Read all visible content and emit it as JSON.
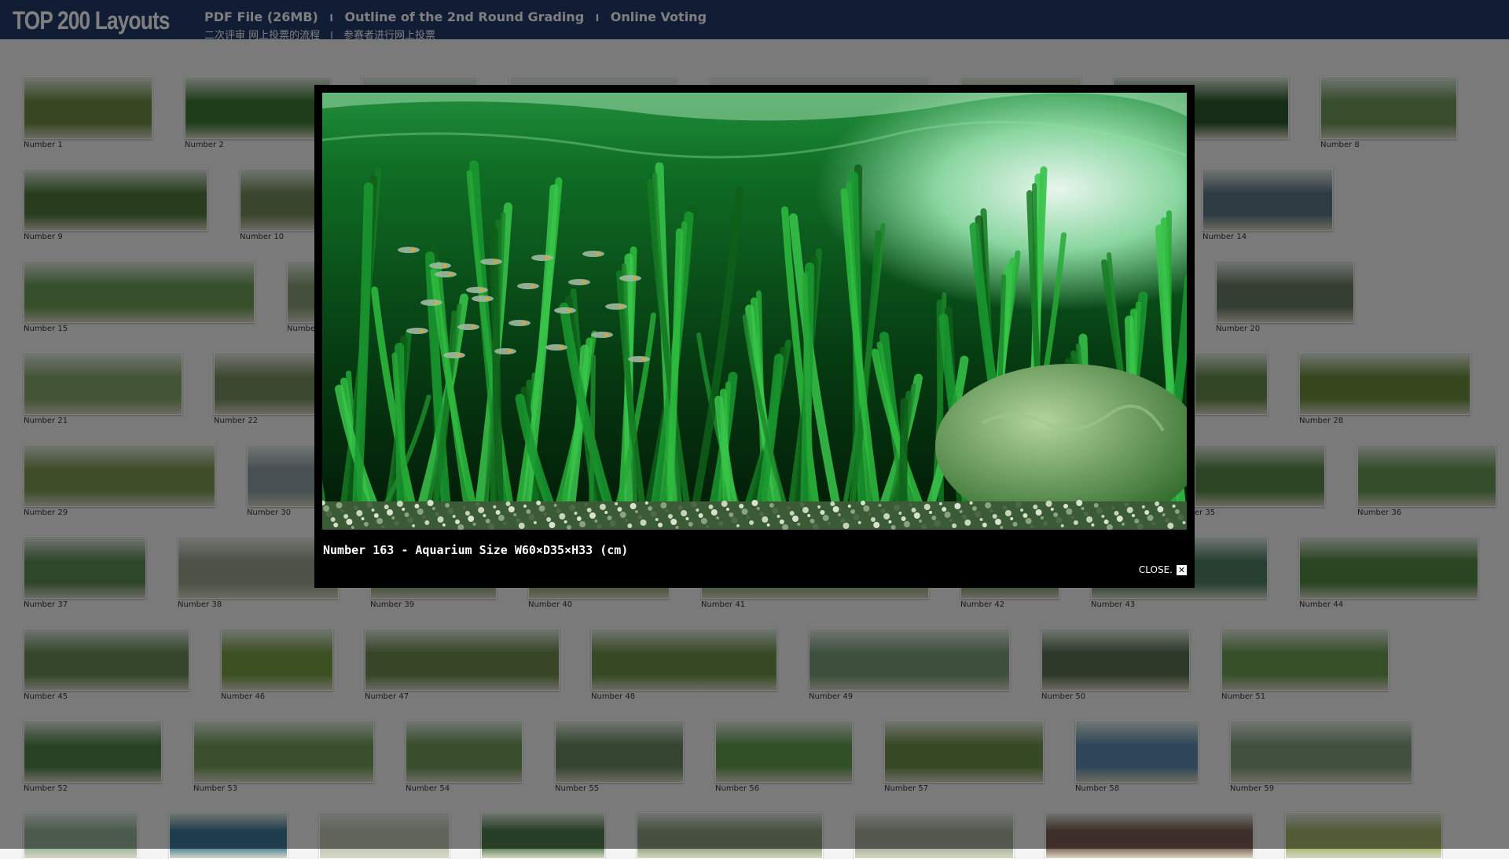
{
  "header": {
    "logo": "TOP 200 Layouts",
    "links": [
      "PDF File (26MB)",
      "Outline of the 2nd Round Grading",
      "Online Voting"
    ],
    "separator": "I",
    "sub_links": [
      "二次评审 网上投票的流程",
      "参赛者进行网上投票"
    ]
  },
  "gallery": {
    "items": [
      {
        "label": "Number 1",
        "c": "#6d8f45"
      },
      {
        "label": "Number 2",
        "c": "#3f7a35"
      },
      {
        "label": "",
        "c": "#96b79a"
      },
      {
        "label": "",
        "c": "#b2c4c6"
      },
      {
        "label": "",
        "c": "#bfcfcf"
      },
      {
        "label": "",
        "c": "#8fb66a"
      },
      {
        "label": "",
        "c": "#2f5b2c"
      },
      {
        "label": "Number 8",
        "c": "#6e9a57"
      },
      {
        "label": "Number 9",
        "c": "#4f7b3a"
      },
      {
        "label": "Number 10",
        "c": "#758d5b"
      },
      {
        "label": "Number 14",
        "c": "#5b7986"
      },
      {
        "label": "Number 15",
        "c": "#6f9f55"
      },
      {
        "label": "Number",
        "c": "#8aa27a"
      },
      {
        "label": "Number 20",
        "c": "#687c66"
      },
      {
        "label": "Number 21",
        "c": "#88a86c"
      },
      {
        "label": "Number 22",
        "c": "#7a9160"
      },
      {
        "label": "",
        "c": "#678d4a"
      },
      {
        "label": "Number 28",
        "c": "#6c8f3a"
      },
      {
        "label": "Number 29",
        "c": "#7c9c52"
      },
      {
        "label": "Number 30",
        "c": "#8fa0a6"
      },
      {
        "label": "er 35",
        "c": "#5a8b48"
      },
      {
        "label": "Number 36",
        "c": "#6a9a56"
      },
      {
        "label": "Number 37",
        "c": "#5d8e56"
      },
      {
        "label": "Number 38",
        "c": "#9aa38c"
      },
      {
        "label": "Number 39",
        "c": "#6e9c5c"
      },
      {
        "label": "Number 40",
        "c": "#749a50"
      },
      {
        "label": "Number 41",
        "c": "#7aa061"
      },
      {
        "label": "Number 42",
        "c": "#628e58"
      },
      {
        "label": "Number 43",
        "c": "#4f8064"
      },
      {
        "label": "Number 44",
        "c": "#548a42"
      },
      {
        "label": "Number 45",
        "c": "#6c8d56"
      },
      {
        "label": "Number 46",
        "c": "#79a045"
      },
      {
        "label": "Number 47",
        "c": "#6f8c4e"
      },
      {
        "label": "Number 48",
        "c": "#6f944a"
      },
      {
        "label": "Number 49",
        "c": "#7c9f7a"
      },
      {
        "label": "Number 50",
        "c": "#5a7253"
      },
      {
        "label": "Number 51",
        "c": "#6fa053"
      },
      {
        "label": "Number 52",
        "c": "#508648"
      },
      {
        "label": "Number 53",
        "c": "#74a058"
      },
      {
        "label": "Number 54",
        "c": "#6e9a59"
      },
      {
        "label": "Number 55",
        "c": "#6a8a62"
      },
      {
        "label": "Number 56",
        "c": "#63a050"
      },
      {
        "label": "Number 57",
        "c": "#6f9148"
      },
      {
        "label": "Number 58",
        "c": "#5d8db0"
      },
      {
        "label": "Number 59",
        "c": "#83a07e"
      },
      {
        "label": "",
        "c": "#98b59b"
      },
      {
        "label": "",
        "c": "#3f7d9a"
      },
      {
        "label": "",
        "c": "#c0c8b6"
      },
      {
        "label": "",
        "c": "#4e7d4f"
      },
      {
        "label": "",
        "c": "#8fa181"
      },
      {
        "label": "",
        "c": "#a6b39c"
      },
      {
        "label": "",
        "c": "#7b5c52"
      },
      {
        "label": "",
        "c": "#a4b66a"
      }
    ]
  },
  "lightbox": {
    "caption": "Number 163 - Aquarium Size W60×D35×H33 (cm)",
    "close_label": "CLOSE.",
    "close_icon": "close-icon",
    "close_glyph": "✕"
  },
  "colors": {
    "header_bg": "#203a6a",
    "page_bg": "#f4f4f4",
    "lightbox_bg": "#000000",
    "overlay": "rgba(0,0,0,0.5)"
  }
}
